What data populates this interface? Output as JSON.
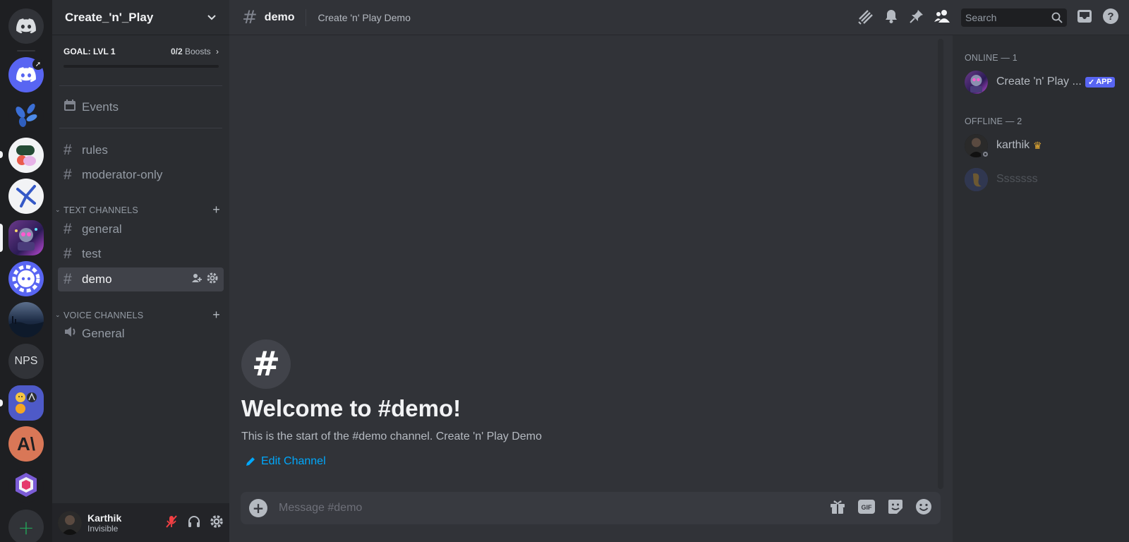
{
  "rail": {
    "servers": [
      {
        "name": "Discord Home",
        "icon": "discord-logo-icon",
        "color": "#313338"
      },
      {
        "name": "Discord boosted",
        "icon": "discord-logo-icon",
        "color": "#5865f2"
      },
      {
        "name": "Leaf server",
        "icon": "leaf-icon",
        "color": "#1e1f22"
      },
      {
        "name": "Pill server",
        "icon": "pill-icon",
        "color": "#f2f3f5"
      },
      {
        "name": "Y server",
        "icon": "y-icon",
        "color": "#f2f3f5"
      },
      {
        "name": "Create_'n'_Play",
        "icon": "robot-icon",
        "color": "#6b3a8a"
      },
      {
        "name": "Gear Discord",
        "icon": "gear-discord-icon",
        "color": "#5865f2"
      },
      {
        "name": "Landscape",
        "icon": "landscape-icon",
        "color": "#2e3f58"
      },
      {
        "name": "NPS",
        "icon": "text",
        "label": "NPS",
        "color": "#313338"
      },
      {
        "name": "Emoji folder",
        "icon": "folder-icon",
        "color": "#4e5ac8"
      },
      {
        "name": "Anthropic",
        "icon": "ai-icon",
        "label": "A\\",
        "color": "#d97757"
      },
      {
        "name": "Q server",
        "icon": "q-icon",
        "color": "#1e1f22"
      }
    ],
    "add_label": "+"
  },
  "guild": {
    "name": "Create_'n'_Play",
    "boost_goal": "GOAL: LVL 1",
    "boost_count": "0/2",
    "boost_suffix": "Boosts",
    "boost_progress": 0
  },
  "sidebar": {
    "events_label": "Events",
    "channels_top": [
      {
        "name": "rules"
      },
      {
        "name": "moderator-only"
      }
    ],
    "text_category": "TEXT CHANNELS",
    "text_channels": [
      {
        "name": "general"
      },
      {
        "name": "test"
      },
      {
        "name": "demo"
      }
    ],
    "voice_category": "VOICE CHANNELS",
    "voice_channels": [
      {
        "name": "General"
      }
    ]
  },
  "user": {
    "name": "Karthik",
    "status": "Invisible"
  },
  "header": {
    "channel": "demo",
    "topic": "Create 'n' Play Demo",
    "search_placeholder": "Search"
  },
  "chat": {
    "welcome_title": "Welcome to #demo!",
    "welcome_sub": "This is the start of the #demo channel. Create 'n' Play Demo",
    "edit_label": "Edit Channel",
    "composer_placeholder": "Message #demo"
  },
  "members": {
    "online_header": "ONLINE — 1",
    "offline_header": "OFFLINE — 2",
    "online": [
      {
        "name": "Create 'n' Play ...",
        "badge": "APP"
      }
    ],
    "offline": [
      {
        "name": "karthik",
        "crown": "♛"
      },
      {
        "name": "Sssssss"
      }
    ]
  },
  "colors": {
    "accent": "#5865f2",
    "link": "#00a8fc",
    "green": "#23a559",
    "crown": "#f0b232",
    "mute_red": "#f23f43"
  }
}
